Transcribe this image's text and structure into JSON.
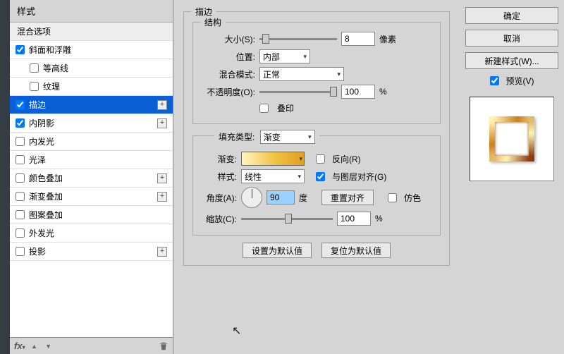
{
  "labels": {
    "styles_header": "样式",
    "blending_options": "混合选项",
    "bevel": "斜面和浮雕",
    "contour": "等高线",
    "texture": "纹理",
    "stroke": "描边",
    "inner_shadow": "内阴影",
    "inner_glow": "内发光",
    "satin": "光泽",
    "color_overlay": "颜色叠加",
    "gradient_overlay": "渐变叠加",
    "pattern_overlay": "图案叠加",
    "outer_glow": "外发光",
    "drop_shadow": "投影",
    "fx": "fx"
  },
  "main": {
    "title": "描边",
    "structure": "结构",
    "size_label": "大小(S):",
    "size_value": "8",
    "size_unit": "像素",
    "position_label": "位置:",
    "position_value": "内部",
    "blend_mode_label": "混合模式:",
    "blend_mode_value": "正常",
    "opacity_label": "不透明度(O):",
    "opacity_value": "100",
    "opacity_unit": "%",
    "overprint_label": "叠印",
    "fill_type_label": "填充类型:",
    "fill_type_value": "渐变",
    "gradient_label": "渐变:",
    "reverse_label": "反向(R)",
    "style_label": "样式:",
    "style_value": "线性",
    "align_label": "与图层对齐(G)",
    "angle_label": "角度(A):",
    "angle_value": "90",
    "angle_unit": "度",
    "reset_align": "重置对齐",
    "dither_label": "仿色",
    "scale_label": "缩放(C):",
    "scale_value": "100",
    "scale_unit": "%",
    "make_default": "设置为默认值",
    "reset_default": "复位为默认值"
  },
  "right": {
    "ok": "确定",
    "cancel": "取消",
    "new_style": "新建样式(W)...",
    "preview": "预览(V)"
  }
}
